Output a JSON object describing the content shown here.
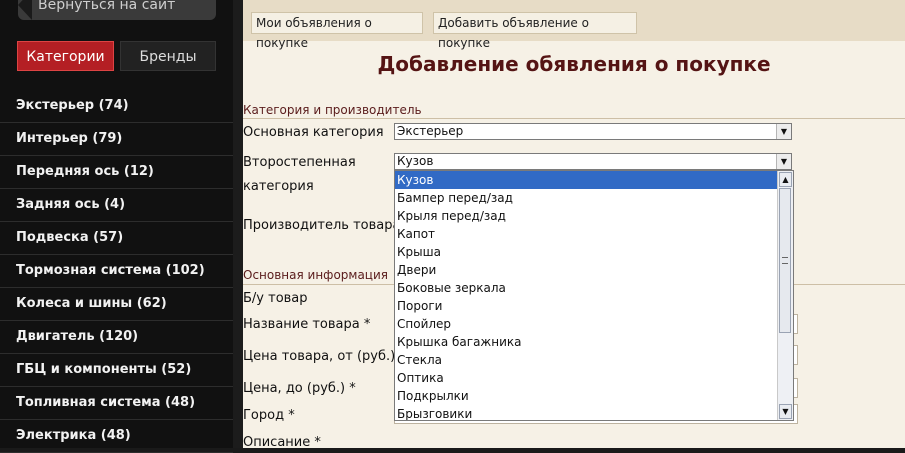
{
  "sidebar": {
    "back_label": "Вернуться на сайт",
    "tabs": {
      "categories": "Категории",
      "brands": "Бренды"
    },
    "items": [
      "Экстерьер (74)",
      "Интерьер (79)",
      "Передняя ось (12)",
      "Задняя ось (4)",
      "Подвеска (57)",
      "Тормозная система (102)",
      "Колеса и шины (62)",
      "Двигатель (120)",
      "ГБЦ и компоненты (52)",
      "Топливная система (48)",
      "Электрика (48)"
    ]
  },
  "topbar": {
    "my_ads": "Мои объявления о покупке",
    "add_ad": "Добавить объявление о покупке"
  },
  "page_title": "Добавление обявления о покупке",
  "form": {
    "section_category": "Категория и производитель",
    "main_category_label": "Основная категория",
    "main_category_value": "Экстерьер",
    "secondary_label_1": "Второстепенная",
    "secondary_label_2": "категория",
    "secondary_value": "Кузов",
    "manufacturer_label": "Производитель товара",
    "section_main": "Основная информация",
    "used_label": "Б/у товар",
    "name_label": "Название товара *",
    "price_from_label": "Цена товара, от (руб.)",
    "price_to_label": "Цена, до (руб.) *",
    "city_label": "Город *",
    "description_label": "Описание *"
  },
  "dropdown": {
    "options": [
      "Кузов",
      "Бампер перед/зад",
      "Крыля перед/зад",
      "Капот",
      "Крыша",
      "Двери",
      "Боковые зеркала",
      "Пороги",
      "Спойлер",
      "Крышка багажника",
      "Стекла",
      "Оптика",
      "Подкрылки",
      "Брызговики"
    ],
    "selected_index": 0
  },
  "colors": {
    "accent_red": "#b41f24",
    "title_color": "#551414",
    "selected_option": "#316ac5"
  }
}
